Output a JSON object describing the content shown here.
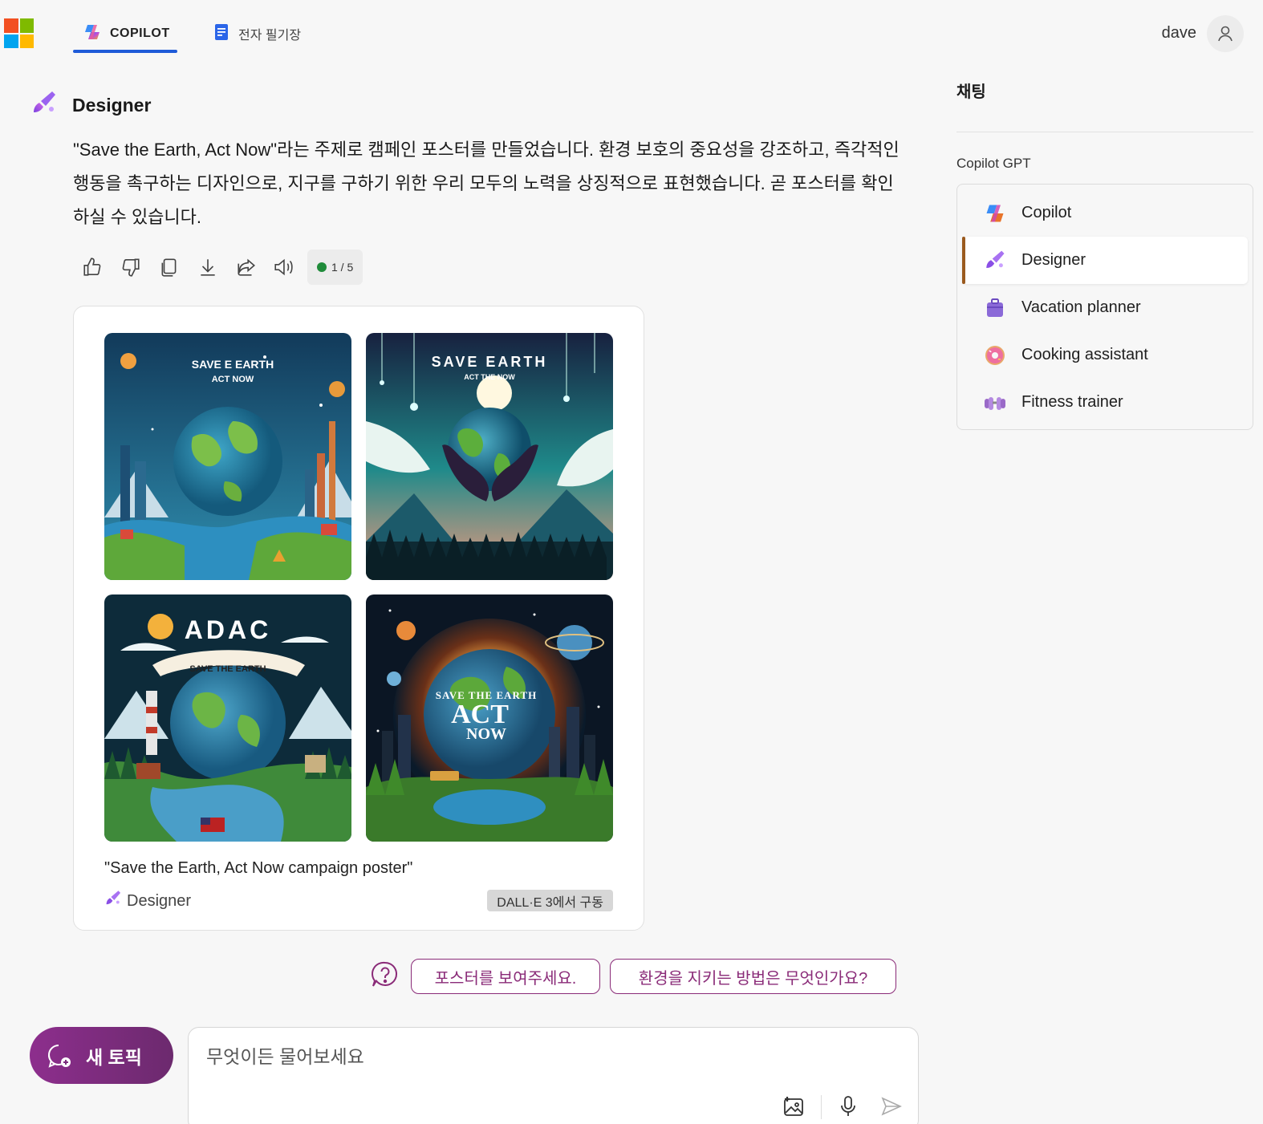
{
  "brand": {
    "logo_colors": [
      "#f25022",
      "#7fba00",
      "#00a4ef",
      "#ffb900"
    ]
  },
  "header": {
    "tabs": [
      {
        "label": "COPILOT",
        "active": true
      },
      {
        "label": "전자 필기장",
        "active": false
      }
    ],
    "user_name": "dave"
  },
  "conversation": {
    "sender": "Designer",
    "message": "\"Save the Earth, Act Now\"라는 주제로 캠페인 포스터를 만들었습니다. 환경 보호의 중요성을 강조하고, 즉각적인 행동을 촉구하는 디자인으로, 지구를 구하기 위한 우리 모두의 노력을 상징적으로 표현했습니다. 곧 포스터를 확인하실 수 있습니다.",
    "response_counter": "1 / 5"
  },
  "image_card": {
    "images": [
      {
        "text_line1": "SAVE E EARTH",
        "text_line2": "ACT NOW"
      },
      {
        "text_line1": "SAVE EARTH",
        "text_line2": "ACT THE NOW"
      },
      {
        "text_line1": "ADAC",
        "text_line2": "SAVE THE EARTH"
      },
      {
        "text_line1": "SAVE THE EARTH",
        "text_line2": "ACT",
        "text_line3": "NOW"
      }
    ],
    "caption": "\"Save the Earth, Act Now campaign poster\"",
    "source_label": "Designer",
    "badge": "DALL·E 3에서 구동"
  },
  "suggestions": [
    "포스터를 보여주세요.",
    "환경을 지키는 방법은 무엇인가요?"
  ],
  "composer": {
    "new_topic_label": "새 토픽",
    "placeholder": "무엇이든 물어보세요"
  },
  "sidebar": {
    "title": "채팅",
    "section_label": "Copilot GPT",
    "items": [
      {
        "label": "Copilot",
        "icon": "copilot-icon",
        "active": false
      },
      {
        "label": "Designer",
        "icon": "designer-icon",
        "active": true
      },
      {
        "label": "Vacation planner",
        "icon": "suitcase-icon",
        "active": false
      },
      {
        "label": "Cooking assistant",
        "icon": "donut-icon",
        "active": false
      },
      {
        "label": "Fitness trainer",
        "icon": "dumbbell-icon",
        "active": false
      }
    ]
  },
  "colors": {
    "accent_blue": "#1f5bd8",
    "accent_purple": "#8a2b78",
    "active_marker": "#9a5a1e"
  }
}
